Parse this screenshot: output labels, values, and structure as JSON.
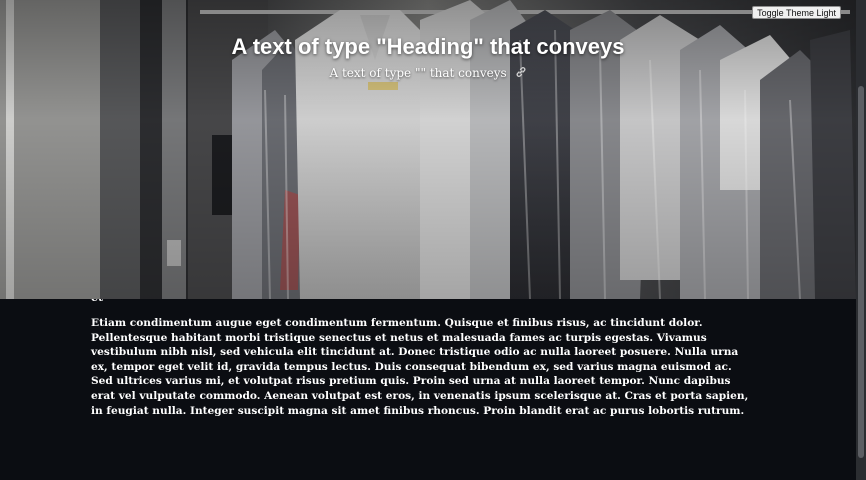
{
  "hero": {
    "title": "A text of type \"Heading\" that conveys",
    "subtitle": "A text of type \"\" that conveys",
    "image_icon": "hanging-garments-photo",
    "link_icon": "link-icon"
  },
  "toolbar": {
    "toggle_label": "Toggle Theme Light"
  },
  "article": {
    "clipped_text": "et",
    "paragraph": "Etiam condimentum augue eget condimentum fermentum. Quisque et finibus risus, ac tincidunt dolor. Pellentesque habitant morbi tristique senectus et netus et malesuada fames ac turpis egestas. Vivamus vestibulum nibh nisl, sed vehicula elit tincidunt at. Donec tristique odio ac nulla laoreet posuere. Nulla urna ex, tempor eget velit id, gravida tempus lectus. Duis consequat bibendum ex, sed varius magna euismod ac. Sed ultrices varius mi, et volutpat risus pretium quis. Proin sed urna at nulla laoreet tempor. Nunc dapibus erat vel vulputate commodo. Aenean volutpat est eros, in venenatis ipsum scelerisque at. Cras et porta sapien, in feugiat nulla. Integer suscipit magna sit amet finibus rhoncus. Proin blandit erat ac purus lobortis rutrum."
  },
  "colors": {
    "page_background": "#0b0d12",
    "text": "#ffffff"
  }
}
